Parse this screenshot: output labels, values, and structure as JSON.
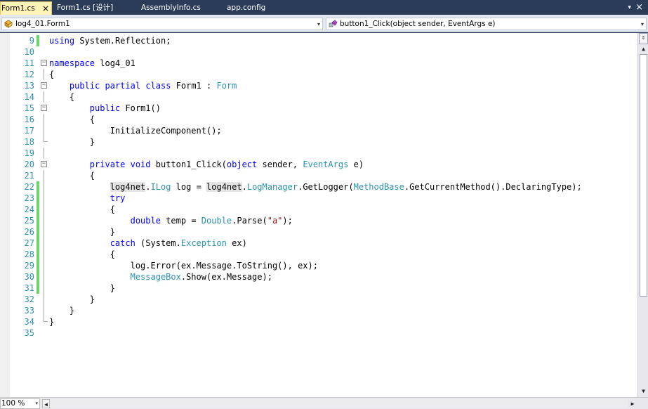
{
  "tabs": [
    {
      "label": "Form1.cs",
      "active": true
    },
    {
      "label": "Form1.cs [设计]",
      "active": false
    },
    {
      "label": "AssemblyInfo.cs",
      "active": false
    },
    {
      "label": "app.config",
      "active": false
    }
  ],
  "tab_close_glyph": "×",
  "tab_dropdown_glyph": "▾",
  "window_close_glyph": "×",
  "navigation": {
    "type_selector": "log4_01.Form1",
    "member_selector": "button1_Click(object sender, EventArgs e)",
    "arrow_glyph": "▾"
  },
  "editor": {
    "lines": [
      {
        "n": "9",
        "text": "using System.Reflection;",
        "changed": true
      },
      {
        "n": "10",
        "text": "",
        "changed": false
      },
      {
        "n": "11",
        "text": "namespace log4_01",
        "changed": false
      },
      {
        "n": "12",
        "text": "{",
        "changed": false
      },
      {
        "n": "13",
        "text": "    public partial class Form1 : Form",
        "changed": false
      },
      {
        "n": "14",
        "text": "    {",
        "changed": false
      },
      {
        "n": "15",
        "text": "        public Form1()",
        "changed": false
      },
      {
        "n": "16",
        "text": "        {",
        "changed": false
      },
      {
        "n": "17",
        "text": "            InitializeComponent();",
        "changed": false
      },
      {
        "n": "18",
        "text": "        }",
        "changed": false
      },
      {
        "n": "19",
        "text": "",
        "changed": false
      },
      {
        "n": "20",
        "text": "        private void button1_Click(object sender, EventArgs e)",
        "changed": false
      },
      {
        "n": "21",
        "text": "        {",
        "changed": false
      },
      {
        "n": "22",
        "text": "            log4net.ILog log = log4net.LogManager.GetLogger(MethodBase.GetCurrentMethod().DeclaringType);",
        "changed": true
      },
      {
        "n": "23",
        "text": "            try",
        "changed": true
      },
      {
        "n": "24",
        "text": "            {",
        "changed": true
      },
      {
        "n": "25",
        "text": "                double temp = Double.Parse(\"a\");",
        "changed": true
      },
      {
        "n": "26",
        "text": "            }",
        "changed": true
      },
      {
        "n": "27",
        "text": "            catch (System.Exception ex)",
        "changed": true
      },
      {
        "n": "28",
        "text": "            {",
        "changed": true
      },
      {
        "n": "29",
        "text": "                log.Error(ex.Message.ToString(), ex);",
        "changed": true
      },
      {
        "n": "30",
        "text": "                MessageBox.Show(ex.Message);",
        "changed": true
      },
      {
        "n": "31",
        "text": "            }",
        "changed": true
      },
      {
        "n": "32",
        "text": "        }",
        "changed": false
      },
      {
        "n": "33",
        "text": "    }",
        "changed": false
      },
      {
        "n": "34",
        "text": "}",
        "changed": false
      },
      {
        "n": "35",
        "text": "",
        "changed": false
      }
    ],
    "keywords": [
      "using",
      "namespace",
      "public",
      "partial",
      "class",
      "private",
      "void",
      "object",
      "try",
      "catch",
      "double"
    ],
    "types": [
      "Form",
      "EventArgs",
      "ILog",
      "LogManager",
      "MethodBase",
      "Double",
      "Exception",
      "MessageBox"
    ],
    "highlighted_words": [
      "log4net"
    ],
    "colors": {
      "keyword": "#0000ff",
      "type": "#2b91af",
      "string": "#a31515",
      "line_number": "#2b91af",
      "change_bar": "#6cd66c",
      "active_tab": "#fff3b8",
      "chrome_background": "#2b3c59"
    }
  },
  "scrollbar": {
    "split_glyph": "⇕",
    "up_glyph": "▲",
    "down_glyph": "▼",
    "left_glyph": "◀",
    "right_glyph": "▶",
    "thumb_fraction": 0.73
  },
  "zoom": {
    "value": "100 %"
  }
}
